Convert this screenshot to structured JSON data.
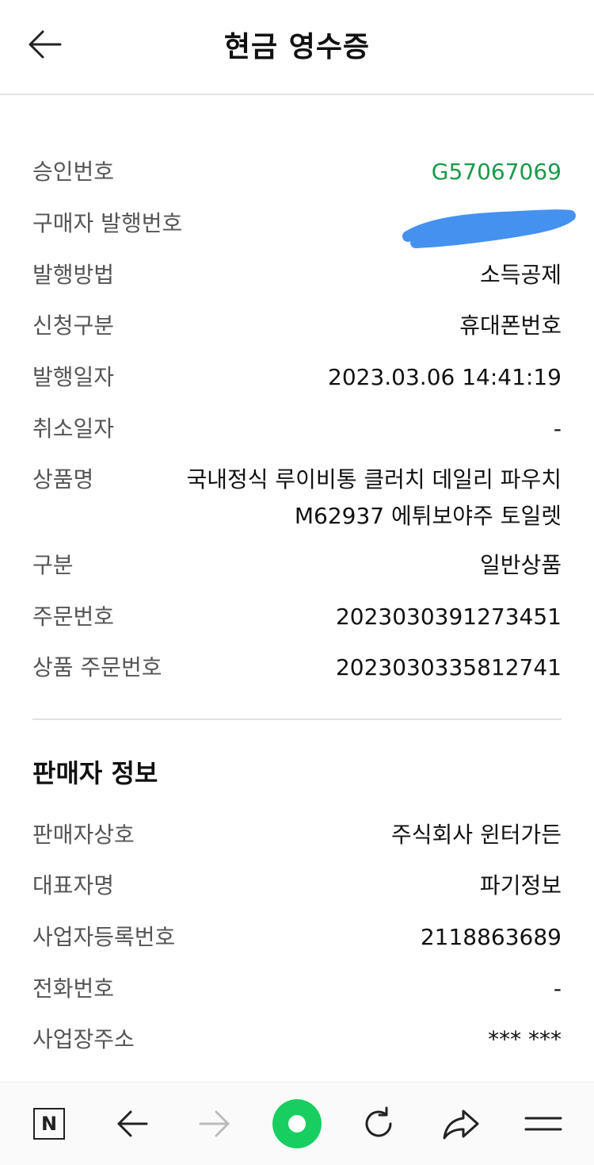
{
  "header": {
    "title": "현금 영수증"
  },
  "receipt": {
    "approval_number": {
      "label": "승인번호",
      "value": "G57067069",
      "color": "#1a9a4a"
    },
    "buyer_issue_number": {
      "label": "구매자 발행번호",
      "value": ""
    },
    "issue_method": {
      "label": "발행방법",
      "value": "소득공제"
    },
    "request_type": {
      "label": "신청구분",
      "value": "휴대폰번호"
    },
    "issue_date": {
      "label": "발행일자",
      "value": "2023.03.06 14:41:19"
    },
    "cancel_date": {
      "label": "취소일자",
      "value": "-"
    },
    "product_name": {
      "label": "상품명",
      "value": "국내정식 루이비통 클러치 데일리 파우치 M62937 에튀보야주 토일렛"
    },
    "category": {
      "label": "구분",
      "value": "일반상품"
    },
    "order_number": {
      "label": "주문번호",
      "value": "2023030391273451"
    },
    "product_order_number": {
      "label": "상품 주문번호",
      "value": "2023030335812741"
    }
  },
  "seller": {
    "section_title": "판매자 정보",
    "business_name": {
      "label": "판매자상호",
      "value": "주식회사 윈터가든"
    },
    "representative": {
      "label": "대표자명",
      "value": "파기정보"
    },
    "business_reg_number": {
      "label": "사업자등록번호",
      "value": "2118863689"
    },
    "phone": {
      "label": "전화번호",
      "value": "-"
    },
    "address": {
      "label": "사업장주소",
      "value": "*** ***"
    }
  },
  "bottom_nav": {
    "items": [
      "n-home-icon",
      "back-arrow-icon",
      "forward-arrow-icon",
      "green-dot-icon",
      "refresh-icon",
      "share-icon",
      "menu-icon"
    ],
    "accent": "#19ce60"
  }
}
